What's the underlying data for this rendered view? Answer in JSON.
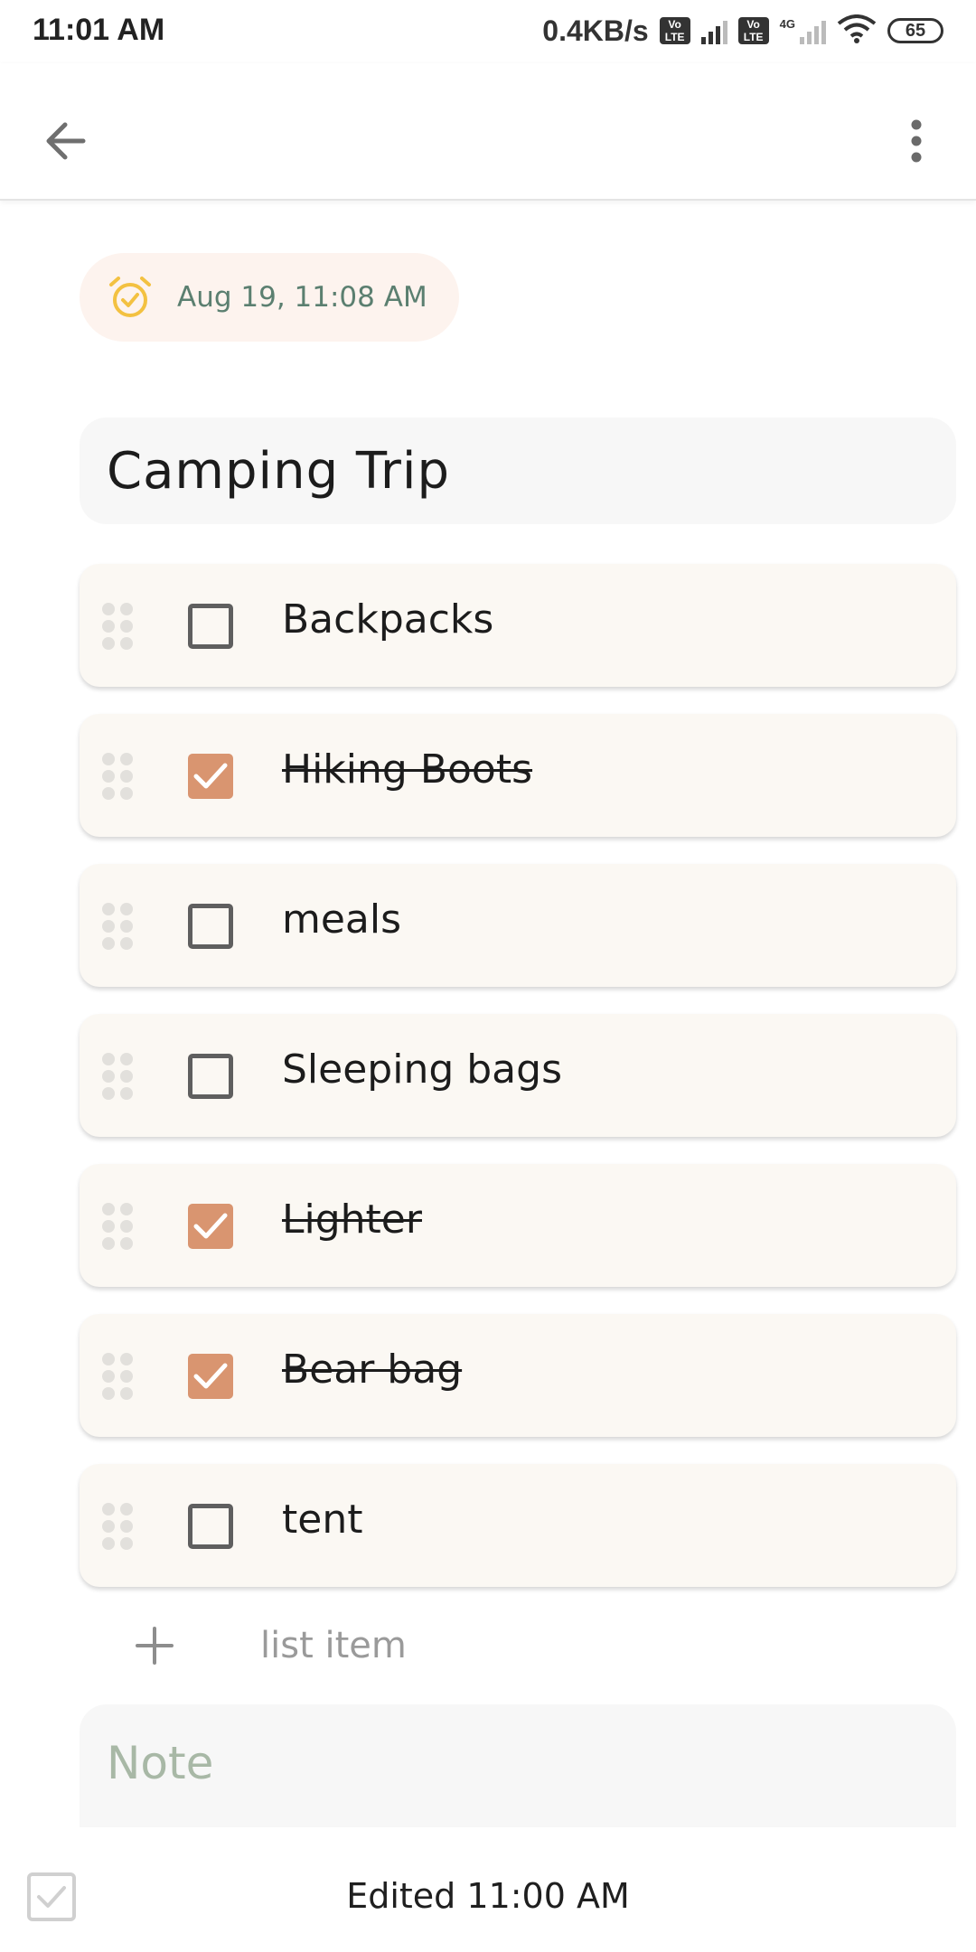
{
  "status_bar": {
    "time": "11:01 AM",
    "net_speed": "0.4KB/s",
    "volte_label": "Vo LTE",
    "network_type": "4G",
    "battery": "65"
  },
  "app_bar": {
    "back_icon": "arrow-back-icon",
    "menu_icon": "more-vert-icon"
  },
  "reminder": {
    "icon": "alarm-check-icon",
    "text": "Aug 19, 11:08 AM",
    "icon_color": "#f3c141"
  },
  "note": {
    "title": "Camping Trip",
    "note_placeholder": "Note"
  },
  "checklist": {
    "items": [
      {
        "label": "Backpacks",
        "checked": false
      },
      {
        "label": "Hiking Boots",
        "checked": true
      },
      {
        "label": "meals",
        "checked": false
      },
      {
        "label": "Sleeping bags",
        "checked": false
      },
      {
        "label": "Lighter",
        "checked": true
      },
      {
        "label": "Bear bag",
        "checked": true
      },
      {
        "label": "tent",
        "checked": false
      }
    ],
    "add_item_label": "list item",
    "check_color": "#d99570"
  },
  "footer": {
    "edited": "Edited  11:00 AM"
  }
}
